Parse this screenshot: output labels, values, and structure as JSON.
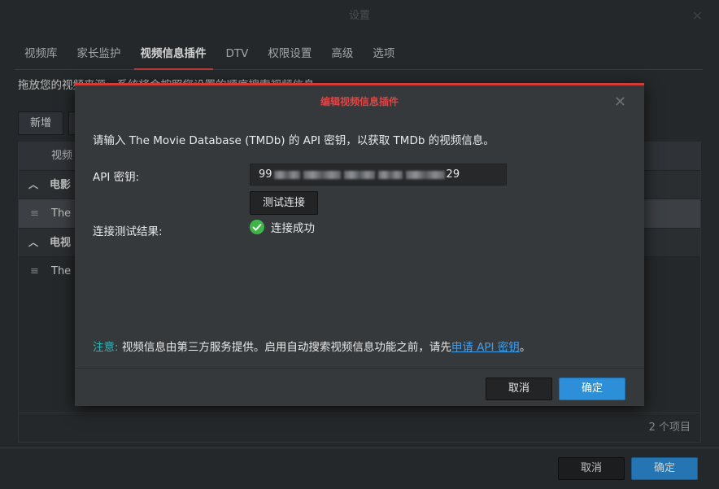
{
  "window": {
    "title": "设置"
  },
  "tabs": [
    {
      "label": "视频库"
    },
    {
      "label": "家长监护"
    },
    {
      "label": "视频信息插件",
      "active": true
    },
    {
      "label": "DTV"
    },
    {
      "label": "权限设置"
    },
    {
      "label": "高级"
    },
    {
      "label": "选项"
    }
  ],
  "description": "拖放您的视频来源，系统将会按照您设置的顺序搜索视频信息。",
  "toolbar": {
    "add_label": "新增"
  },
  "grid": {
    "column_header": "视频",
    "groups": [
      {
        "label": "电影",
        "rows": [
          {
            "label": "The M"
          }
        ]
      },
      {
        "label": "电视",
        "rows": [
          {
            "label": "The M"
          }
        ]
      }
    ],
    "footer_count": "2 个项目"
  },
  "bottom": {
    "cancel_label": "取消",
    "ok_label": "确定"
  },
  "modal": {
    "title": "编辑视频信息插件",
    "intro": "请输入 The Movie Database (TMDb) 的 API 密钥，以获取 TMDb 的视频信息。",
    "api_key_label": "API 密钥:",
    "api_key_prefix": "99",
    "api_key_suffix": "29",
    "test_button_label": "测试连接",
    "test_result_label": "连接测试结果:",
    "test_result_value": "连接成功",
    "note_label": "注意:",
    "note_text": " 视频信息由第三方服务提供。启用自动搜索视频信息功能之前，请先",
    "note_link": "申请 API 密钥",
    "note_end": "。",
    "cancel_label": "取消",
    "ok_label": "确定"
  },
  "colors": {
    "accent_red": "#e04a48",
    "primary_blue": "#2d8fd8",
    "success_green": "#3fb548",
    "note_teal": "#31b4b4"
  }
}
